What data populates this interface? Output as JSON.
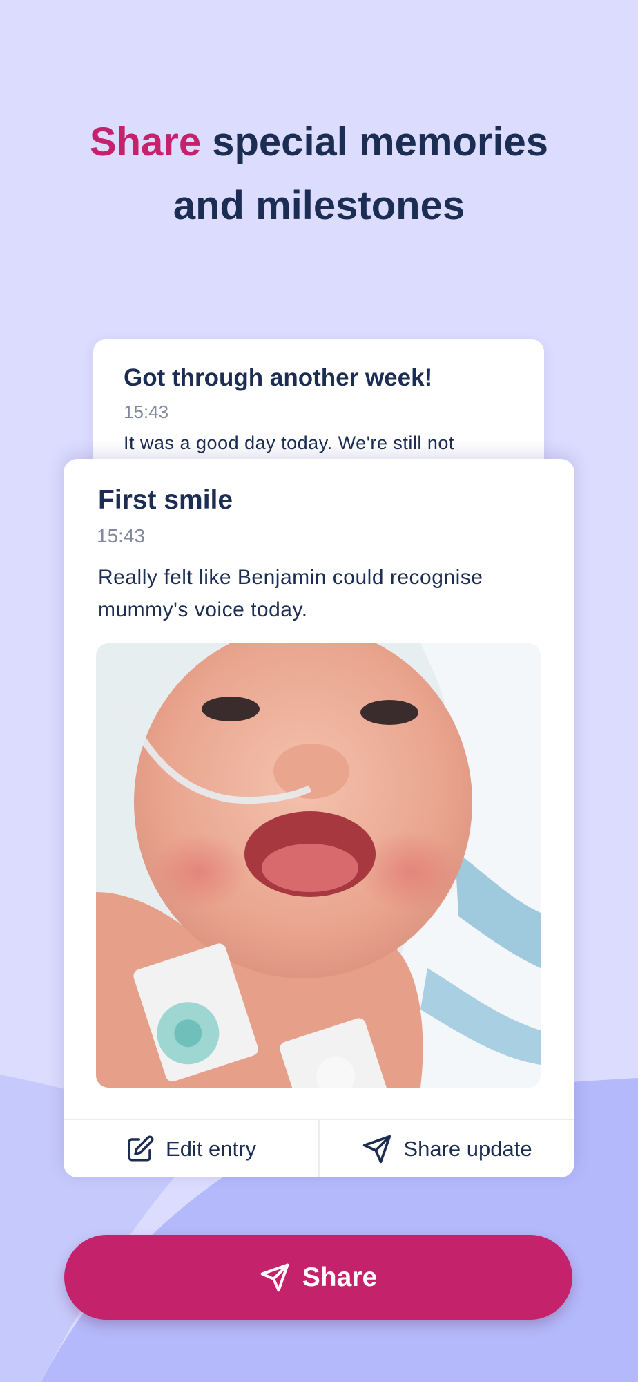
{
  "colors": {
    "background": "#dcdcff",
    "wave": "#b3b9fb",
    "accent": "#c4226b",
    "heading": "#1b2d52",
    "muted": "#8088a0"
  },
  "headline": {
    "accent_word": "Share",
    "line1_rest": " special memories",
    "line2": "and milestones"
  },
  "back_entry": {
    "title": "Got through another week!",
    "time": "15:43",
    "body": "It was a good day today. We're still not"
  },
  "front_entry": {
    "title": "First smile",
    "time": "15:43",
    "body": "Really felt like Benjamin could recognise mummy's voice today.",
    "photo_icon": "baby-photo",
    "actions": {
      "edit_label": "Edit entry",
      "edit_icon": "edit-icon",
      "share_label": "Share update",
      "share_icon": "send-icon"
    }
  },
  "primary_button": {
    "label": "Share",
    "icon": "send-icon"
  }
}
